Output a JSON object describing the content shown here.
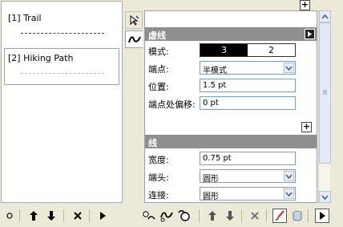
{
  "paths": [
    {
      "label": "[1] Trail",
      "line_color": "#404040",
      "selected": false
    },
    {
      "label": "[2] Hiking Path",
      "line_color": "#f0b840",
      "selected": true
    }
  ],
  "dash_section": {
    "title": "虚线",
    "mode_label": "模式:",
    "mode_values": [
      "3",
      "2"
    ],
    "endpoint_label": "端点:",
    "endpoint_value": "半模式",
    "position_label": "位置:",
    "position_value": "1.5 pt",
    "endpoint_offset_label": "端点处偏移:",
    "endpoint_offset_value": "0 pt"
  },
  "line_section": {
    "title": "线",
    "width_label": "宽度:",
    "width_value": "0.75 pt",
    "cap_label": "端头:",
    "cap_value": "圆形",
    "join_label": "连接:",
    "join_value": "圆形"
  },
  "toolbar": {
    "add": "+",
    "up": "↑",
    "down": "↓",
    "delete": "×",
    "next": "▶"
  }
}
